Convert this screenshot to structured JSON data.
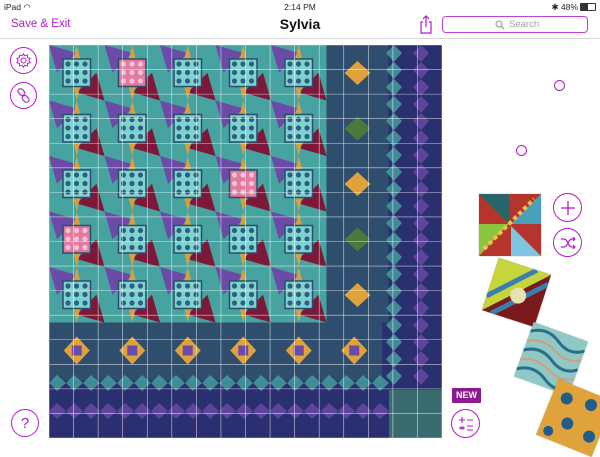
{
  "status_bar": {
    "device": "iPad",
    "time": "2:14 PM",
    "battery": "48%"
  },
  "nav": {
    "save_exit": "Save & Exit",
    "title": "Sylvia",
    "search_placeholder": "Search"
  },
  "sidebar": {
    "settings_icon": "gear-icon",
    "link_icon": "chain-link-icon",
    "help_label": "?"
  },
  "right_tools": {
    "add_icon": "plus-icon",
    "shuffle_icon": "shuffle-icon",
    "calculator_icon": "calculator-icon",
    "new_badge": "NEW"
  },
  "quilt": {
    "rows": 8,
    "cols": 8,
    "grid_color": "#ffffff",
    "background": "#2a2f70"
  },
  "colors": {
    "accent": "#b21bc6",
    "new_badge_bg": "#8d1a8f",
    "teal": "#46a3a0",
    "navy": "#2a2f70",
    "orange": "#e0a23a",
    "maroon": "#7d1838",
    "purple": "#6b4aa8",
    "pink": "#e07aa0"
  }
}
